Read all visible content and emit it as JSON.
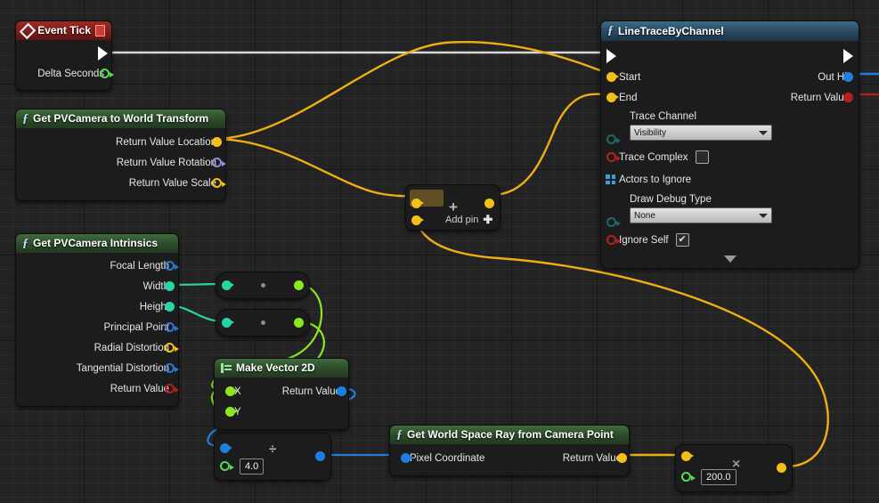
{
  "graph": {
    "background_color": "#232323",
    "grid_minor_color": "#2e2e2e",
    "grid_major_color": "#141414"
  },
  "nodes": {
    "event_tick": {
      "title": "Event Tick",
      "icon": "event-diamond-icon",
      "outputs": [
        {
          "name": "exec",
          "label": "",
          "type": "exec"
        },
        {
          "name": "delta-seconds",
          "label": "Delta Seconds",
          "type": "float",
          "color": "#57d957"
        }
      ]
    },
    "camera_to_world": {
      "title": "Get PVCamera to World Transform",
      "icon": "function-icon",
      "outputs": [
        {
          "label": "Return Value Location",
          "type": "vector",
          "color": "#f4c017"
        },
        {
          "label": "Return Value Rotation",
          "type": "rotator",
          "color": "#8c90db"
        },
        {
          "label": "Return Value Scale",
          "type": "vector",
          "color": "#f4c017"
        }
      ]
    },
    "camera_intrinsics": {
      "title": "Get PVCamera Intrinsics",
      "icon": "function-icon",
      "outputs": [
        {
          "label": "Focal Length",
          "type": "vector2d",
          "color": "#2a79d1"
        },
        {
          "label": "Width",
          "type": "int",
          "color": "#26d4a8"
        },
        {
          "label": "Height",
          "type": "int",
          "color": "#26d4a8"
        },
        {
          "label": "Principal Point",
          "type": "vector2d",
          "color": "#2a79d1"
        },
        {
          "label": "Radial Distortion",
          "type": "vector",
          "color": "#f4c017"
        },
        {
          "label": "Tangential Distortion",
          "type": "vector2d",
          "color": "#2a79d1"
        },
        {
          "label": "Return Value",
          "type": "bool",
          "color": "#b5201f"
        }
      ]
    },
    "line_trace": {
      "title": "LineTraceByChannel",
      "icon": "function-icon",
      "inputs": [
        {
          "label": "Start",
          "type": "vector",
          "color": "#f4c017"
        },
        {
          "label": "End",
          "type": "vector",
          "color": "#f4c017"
        }
      ],
      "outputs": [
        {
          "label": "Out Hit",
          "type": "struct",
          "color": "#1e7fe0"
        },
        {
          "label": "Return Value",
          "type": "bool",
          "color": "#b5201f"
        }
      ],
      "trace_channel_label": "Trace Channel",
      "trace_channel_value": "Visibility",
      "trace_complex_label": "Trace Complex",
      "trace_complex_checked": false,
      "actors_to_ignore_label": "Actors to Ignore",
      "draw_debug_label": "Draw Debug Type",
      "draw_debug_value": "None",
      "ignore_self_label": "Ignore Self",
      "ignore_self_checked": true,
      "expand_icon": "chevron-down-icon"
    },
    "add_node": {
      "operator": "+",
      "add_pin_label": "Add pin",
      "add_pin_icon": "plus-icon"
    },
    "make_vector2d": {
      "title": "Make Vector 2D",
      "icon": "make-struct-icon",
      "inputs": [
        {
          "label": "X",
          "type": "float",
          "color": "#8ce622"
        },
        {
          "label": "Y",
          "type": "float",
          "color": "#8ce622"
        }
      ],
      "outputs": [
        {
          "label": "Return Value",
          "type": "vector2d",
          "color": "#1e7fe0"
        }
      ]
    },
    "divide_node": {
      "operator": "÷",
      "value": "4.0"
    },
    "world_space_ray": {
      "title": "Get World Space Ray from Camera Point",
      "icon": "function-icon",
      "inputs": [
        {
          "label": "Pixel Coordinate",
          "type": "vector2d",
          "color": "#1e7fe0"
        }
      ],
      "outputs": [
        {
          "label": "Return Value",
          "type": "vector",
          "color": "#f4c017"
        }
      ]
    },
    "multiply_node": {
      "operator": "×",
      "value": "200.0"
    },
    "conv_width": {
      "in_color": "#26d4a8",
      "out_color": "#8ce622"
    },
    "conv_height": {
      "in_color": "#26d4a8",
      "out_color": "#8ce622"
    }
  },
  "wire_colors": {
    "exec": "#ffffff",
    "vector": "#eeae14",
    "int": "#26d4a8",
    "float": "#8ce622",
    "vector2d": "#1e7fe0"
  }
}
